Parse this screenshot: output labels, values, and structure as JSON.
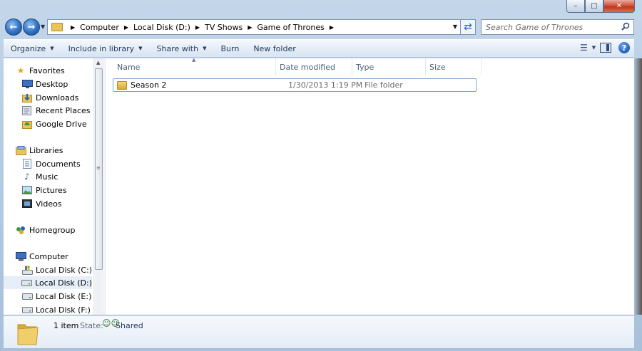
{
  "window": {
    "caption_buttons": {
      "minimize": "–",
      "maximize": "□",
      "close": "✕"
    }
  },
  "address": {
    "crumbs": [
      "Computer",
      "Local Disk (D:)",
      "TV Shows",
      "Game of Thrones"
    ],
    "search_placeholder": "Search Game of Thrones"
  },
  "toolbar": {
    "organize": "Organize",
    "include_in_library": "Include in library",
    "share_with": "Share with",
    "burn": "Burn",
    "new_folder": "New folder"
  },
  "nav": {
    "favorites": {
      "label": "Favorites",
      "items": [
        "Desktop",
        "Downloads",
        "Recent Places",
        "Google Drive"
      ]
    },
    "libraries": {
      "label": "Libraries",
      "items": [
        "Documents",
        "Music",
        "Pictures",
        "Videos"
      ]
    },
    "homegroup": {
      "label": "Homegroup"
    },
    "computer": {
      "label": "Computer",
      "items": [
        "Local Disk (C:)",
        "Local Disk (D:)",
        "Local Disk (E:)",
        "Local Disk (F:)"
      ],
      "selected": "Local Disk (D:)"
    }
  },
  "columns": {
    "name": "Name",
    "date_modified": "Date modified",
    "type": "Type",
    "size": "Size"
  },
  "files": [
    {
      "name": "Season 2",
      "date_modified": "1/30/2013 1:19 PM",
      "type": "File folder",
      "size": ""
    }
  ],
  "details": {
    "count": "1 item",
    "state_label": "State:",
    "state": "Shared"
  },
  "icons": {
    "back": "back-arrow-icon",
    "forward": "forward-arrow-icon",
    "search": "search-icon",
    "refresh": "refresh-icon",
    "help": "help-icon"
  },
  "colors": {
    "frame": "#b7cce3",
    "selection_border": "#7da2ce",
    "toolbar_text": "#1e395b"
  }
}
